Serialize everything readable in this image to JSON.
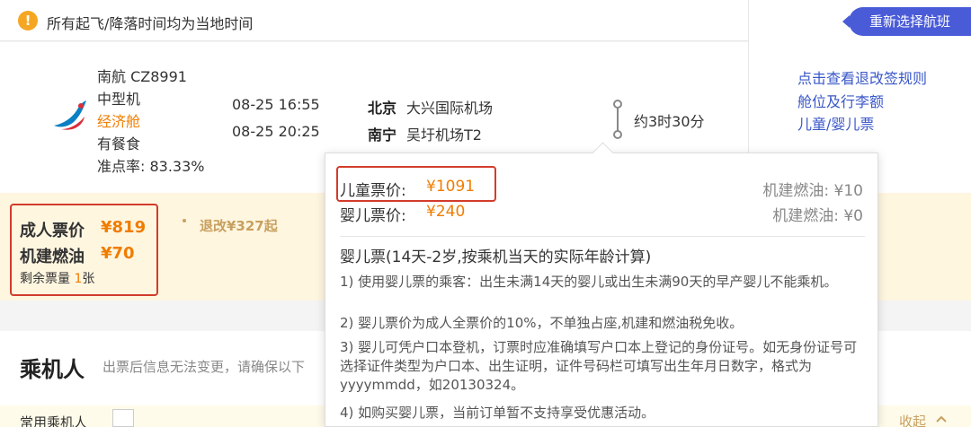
{
  "notice": {
    "icon": "warning-icon",
    "text": "所有起飞/降落时间均为当地时间"
  },
  "right_panel": {
    "reselect_label": "重新选择航班",
    "links": [
      "点击查看退改签规则",
      "舱位及行李额",
      "儿童/婴儿票"
    ]
  },
  "flight": {
    "airline": "南航 CZ8991",
    "aircraft": "中型机",
    "cabin": "经济舱",
    "meal": "有餐食",
    "on_time": "准点率: 83.33%",
    "dep_time": "08-25 16:55",
    "arr_time": "08-25 20:25",
    "dep_city": "北京",
    "dep_airport": "大兴国际机场",
    "arr_city": "南宁",
    "arr_airport": "吴圩机场T2",
    "duration": "约3时30分"
  },
  "fare": {
    "adult_label": "成人票价",
    "adult_price": "¥819",
    "tax_label": "机建燃油",
    "tax_price": "¥70",
    "remaining_prefix": "剩余票量",
    "remaining_count": "1",
    "remaining_unit": "张",
    "refund_note": "退改¥327起"
  },
  "popup": {
    "child_label": "儿童票价:",
    "child_price": "¥1091",
    "infant_label": "婴儿票价:",
    "infant_price": "¥240",
    "child_tax": "机建燃油: ¥10",
    "infant_tax": "机建燃油: ¥0",
    "heading": "婴儿票(14天-2岁,按乘机当天的实际年龄计算)",
    "rules": [
      "1) 使用婴儿票的乘客：出生未满14天的婴儿或出生未满90天的早产婴儿不能乘机。",
      "2) 婴儿票价为成人全票价的10%，不单独占座,机建和燃油税免收。",
      "3) 婴儿可凭户口本登机，订票时应准确填写户口本上登记的身份证号。如无身份证号可选择证件类型为户口本、出生证明，证件号码栏可填写出生年月日数字，格式为yyyymmdd，如20130324。",
      "4) 如购买婴儿票，当前订单暂不支持享受优惠活动。"
    ]
  },
  "passenger": {
    "title": "乘机人",
    "note": "出票后信息无法变更，请确保以下",
    "frequent_label": "常用乘机人",
    "collapse_label": "收起"
  }
}
